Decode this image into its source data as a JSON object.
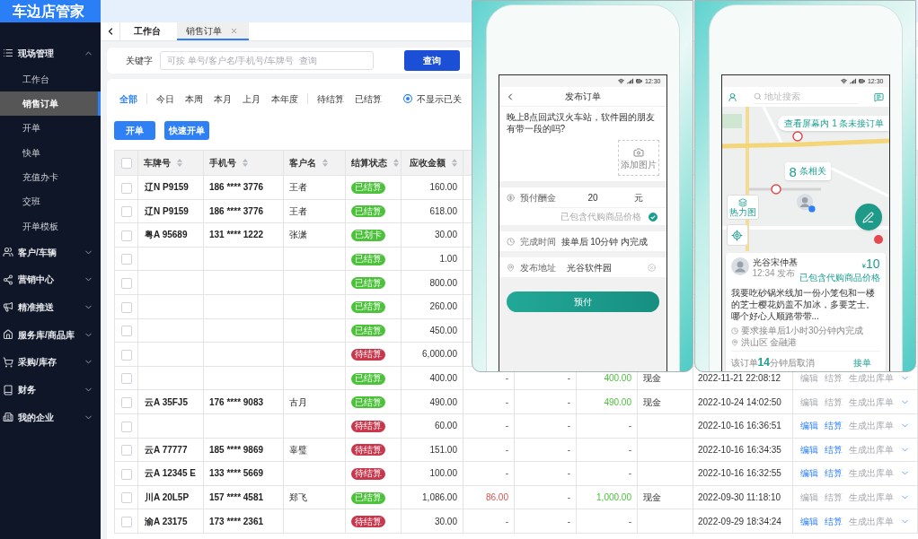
{
  "sidebar": {
    "logo": "车边店管家",
    "groups": [
      {
        "label": "现场管理",
        "expanded": true,
        "children": [
          {
            "label": "工作台",
            "selected": false
          },
          {
            "label": "销售订单",
            "selected": true
          },
          {
            "label": "开单",
            "selected": false
          },
          {
            "label": "快单",
            "selected": false
          },
          {
            "label": "充值办卡",
            "selected": false
          },
          {
            "label": "交班",
            "selected": false
          },
          {
            "label": "开单模板",
            "selected": false
          }
        ]
      },
      {
        "label": "客户/车辆",
        "expanded": false
      },
      {
        "label": "营销中心",
        "expanded": false
      },
      {
        "label": "精准推送",
        "expanded": false
      },
      {
        "label": "服务库/商品库",
        "expanded": false
      },
      {
        "label": "采购/库存",
        "expanded": false
      },
      {
        "label": "财务",
        "expanded": false
      },
      {
        "label": "我的企业",
        "expanded": false
      }
    ]
  },
  "tabs": [
    {
      "label": "工作台",
      "selected": false,
      "closable": false
    },
    {
      "label": "销售订单",
      "selected": true,
      "closable": true
    }
  ],
  "search": {
    "label": "关键字",
    "placeholder": "可按 单号/客户名/手机号/车牌号  查询",
    "button": "查询"
  },
  "filter_groups": [
    [
      {
        "label": "全部",
        "selected": true
      }
    ],
    [
      {
        "label": "今日",
        "selected": false
      },
      {
        "label": "本周",
        "selected": false
      },
      {
        "label": "本月",
        "selected": false
      },
      {
        "label": "上月",
        "selected": false
      },
      {
        "label": "本年度",
        "selected": false
      }
    ],
    [
      {
        "label": "待结算",
        "selected": false
      },
      {
        "label": "已结算",
        "selected": false
      }
    ]
  ],
  "hide_closed": {
    "label": "不显示已关",
    "checked": true
  },
  "buttons": [
    "开单",
    "快速开单"
  ],
  "table": {
    "all_checked": false,
    "columns": [
      "车牌号",
      "手机号",
      "客户名",
      "结算状态",
      "应收金额"
    ],
    "rows": [
      {
        "checked": false,
        "plate": "辽N P9159",
        "phone": "186 **** 3776",
        "customer": "王者",
        "status": {
          "label": "已结算",
          "color": "#4cc23a"
        },
        "amount": "160.00"
      },
      {
        "checked": false,
        "plate": "辽N P9159",
        "phone": "186 **** 3776",
        "customer": "王者",
        "status": {
          "label": "已结算",
          "color": "#4cc23a"
        },
        "amount": "618.00"
      },
      {
        "checked": false,
        "plate": "粤A 95689",
        "phone": "131 **** 1222",
        "customer": "张潇",
        "status": {
          "label": "已划卡",
          "color": "#4cc23a"
        },
        "amount": "30.00"
      },
      {
        "checked": false,
        "status": {
          "label": "已结算",
          "color": "#4cc23a"
        },
        "amount": "1.00"
      },
      {
        "checked": false,
        "status": {
          "label": "已结算",
          "color": "#4cc23a"
        },
        "amount": "800.00"
      },
      {
        "checked": false,
        "status": {
          "label": "已结算",
          "color": "#4cc23a"
        },
        "amount": "260.00"
      },
      {
        "checked": false,
        "status": {
          "label": "已结算",
          "color": "#4cc23a"
        },
        "amount": "450.00"
      },
      {
        "checked": false,
        "status": {
          "label": "待结算",
          "color": "#c8374c"
        },
        "amount": "6,000.00"
      },
      {
        "checked": false,
        "status": {
          "label": "已结算",
          "color": "#4cc23a"
        },
        "amount": "400.00",
        "column_7": {
          "text": "-",
          "kind": "dash"
        },
        "column_8": {
          "text": "-",
          "kind": "dash"
        },
        "column_9": {
          "text": "400.00",
          "kind": "paid"
        },
        "column_10": "现金",
        "column_11": "2022-11-21 22:08:12",
        "actions": [
          {
            "label": "编辑",
            "disabled": true
          },
          {
            "label": "结算",
            "disabled": true
          },
          {
            "label": "生成出库单",
            "disabled": true
          }
        ]
      },
      {
        "checked": false,
        "plate": "云A 35FJ5",
        "phone": "176 **** 9083",
        "customer": "古月",
        "status": {
          "label": "已结算",
          "color": "#4cc23a"
        },
        "amount": "490.00",
        "column_7": {
          "text": "-",
          "kind": "dash"
        },
        "column_8": {
          "text": "-",
          "kind": "dash"
        },
        "column_9": {
          "text": "490.00",
          "kind": "paid"
        },
        "column_10": "现金",
        "column_11": "2022-10-24 14:02:50",
        "actions": [
          {
            "label": "编辑",
            "disabled": true
          },
          {
            "label": "结算",
            "disabled": true
          },
          {
            "label": "生成出库单",
            "disabled": true
          }
        ]
      },
      {
        "checked": false,
        "status": {
          "label": "待结算",
          "color": "#c8374c"
        },
        "amount": "60.00",
        "column_7": {
          "text": "-",
          "kind": "dash"
        },
        "column_8": {
          "text": "-",
          "kind": "dash"
        },
        "column_9": {
          "text": "-",
          "kind": "dash"
        },
        "column_11": "2022-10-16 16:36:51",
        "actions": [
          {
            "label": "编辑",
            "disabled": false
          },
          {
            "label": "结算",
            "disabled": false
          },
          {
            "label": "生成出库单",
            "disabled": true
          }
        ]
      },
      {
        "checked": false,
        "plate": "云A 77777",
        "phone": "185 **** 9869",
        "customer": "辜璧",
        "status": {
          "label": "待结算",
          "color": "#c8374c"
        },
        "amount": "151.00",
        "column_7": {
          "text": "-",
          "kind": "dash"
        },
        "column_8": {
          "text": "-",
          "kind": "dash"
        },
        "column_9": {
          "text": "-",
          "kind": "dash"
        },
        "column_11": "2022-10-16 16:34:35",
        "actions": [
          {
            "label": "编辑",
            "disabled": false
          },
          {
            "label": "结算",
            "disabled": false
          },
          {
            "label": "生成出库单",
            "disabled": true
          }
        ]
      },
      {
        "checked": false,
        "plate": "云A 12345 E",
        "phone": "133 **** 5669",
        "status": {
          "label": "待结算",
          "color": "#c8374c"
        },
        "amount": "100.00",
        "column_7": {
          "text": "-",
          "kind": "dash"
        },
        "column_8": {
          "text": "-",
          "kind": "dash"
        },
        "column_9": {
          "text": "-",
          "kind": "dash"
        },
        "column_11": "2022-10-16 16:32:55",
        "actions": [
          {
            "label": "编辑",
            "disabled": false
          },
          {
            "label": "结算",
            "disabled": false
          },
          {
            "label": "生成出库单",
            "disabled": true
          }
        ]
      },
      {
        "checked": false,
        "plate": "川A 20L5P",
        "phone": "157 **** 4581",
        "customer": "郑飞",
        "status": {
          "label": "已结算",
          "color": "#4cc23a"
        },
        "amount": "1,086.00",
        "column_7": {
          "text": "86.00",
          "kind": "owed"
        },
        "column_8": {
          "text": "-",
          "kind": "dash"
        },
        "column_9": {
          "text": "1,000.00",
          "kind": "paid"
        },
        "column_10": "现金",
        "column_11": "2022-09-30 11:18:10",
        "actions": [
          {
            "label": "编辑",
            "disabled": true
          },
          {
            "label": "结算",
            "disabled": true
          },
          {
            "label": "生成出库单",
            "disabled": true
          }
        ]
      },
      {
        "checked": false,
        "plate": "渝A 23175",
        "phone": "173 **** 2361",
        "status": {
          "label": "待结算",
          "color": "#c8374c"
        },
        "amount": "30.00",
        "column_7": {
          "text": "-",
          "kind": "dash"
        },
        "column_8": {
          "text": "-",
          "kind": "dash"
        },
        "column_9": {
          "text": "-",
          "kind": "dash"
        },
        "column_11": "2022-09-29 18:34:24",
        "actions": [
          {
            "label": "编辑",
            "disabled": false
          },
          {
            "label": "结算",
            "disabled": false
          },
          {
            "label": "生成出库单",
            "disabled": true
          }
        ]
      }
    ]
  },
  "phone_publish": {
    "time": "12:30",
    "title": "发布订单",
    "description": "晚上8点回武汉火车站，软件园的朋友有带一段的吗?",
    "add_photo": "添加图片",
    "reward": {
      "label": "预付酬金",
      "value": "20",
      "unit": "元",
      "note": "已包含代购商品价格",
      "included": true
    },
    "deadline": {
      "label": "完成时间",
      "value": "接单后 10分钟 内完成"
    },
    "address": {
      "label": "发布地址",
      "value": "光谷软件园"
    },
    "submit": "预付"
  },
  "phone_map": {
    "time": "12:30",
    "search": {
      "placeholder": "地址搜索"
    },
    "notice": "查看屏幕内 1 条未接订单",
    "cluster": {
      "count": "8",
      "label": "条相关"
    },
    "heatmap": "热力图",
    "order": {
      "name": "光谷宋仲基",
      "posted": "12:34 发布",
      "currency": "¥",
      "price": "10",
      "price_note": "已包含代购商品价格",
      "description": "我要吃砂锅米线加一份小笼包和一楼的芝士樱花奶盖不加冰，多要芝士。哪个好心人顺路带带...",
      "deadline": "要求接单后1小时30分钟内完成",
      "location": "洪山区 金融港",
      "expiry": "该订单**14**分钟后取消",
      "accept": "接单"
    }
  }
}
